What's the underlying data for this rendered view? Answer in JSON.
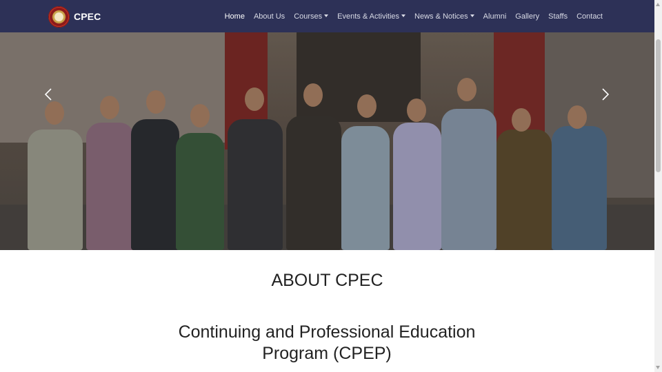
{
  "navbar": {
    "brand": "CPEC",
    "logo_icon": "cpec-emblem-icon",
    "items": [
      {
        "label": "Home",
        "active": true,
        "dropdown": false
      },
      {
        "label": "About Us",
        "active": false,
        "dropdown": false
      },
      {
        "label": "Courses",
        "active": false,
        "dropdown": true
      },
      {
        "label": "Events & Activities",
        "active": false,
        "dropdown": true
      },
      {
        "label": "News & Notices",
        "active": false,
        "dropdown": true
      },
      {
        "label": "Alumni",
        "active": false,
        "dropdown": false
      },
      {
        "label": "Gallery",
        "active": false,
        "dropdown": false
      },
      {
        "label": "Staffs",
        "active": false,
        "dropdown": false
      },
      {
        "label": "Contact",
        "active": false,
        "dropdown": false
      }
    ]
  },
  "hero": {
    "prev_icon": "chevron-left-icon",
    "next_icon": "chevron-right-icon"
  },
  "about": {
    "heading": "ABOUT CPEC",
    "subheading": "Continuing and Professional Education Program (CPEP)"
  },
  "colors": {
    "navbar_bg": "#2d3157",
    "nav_text": "#d9dbe6",
    "nav_active": "#ffffff"
  }
}
